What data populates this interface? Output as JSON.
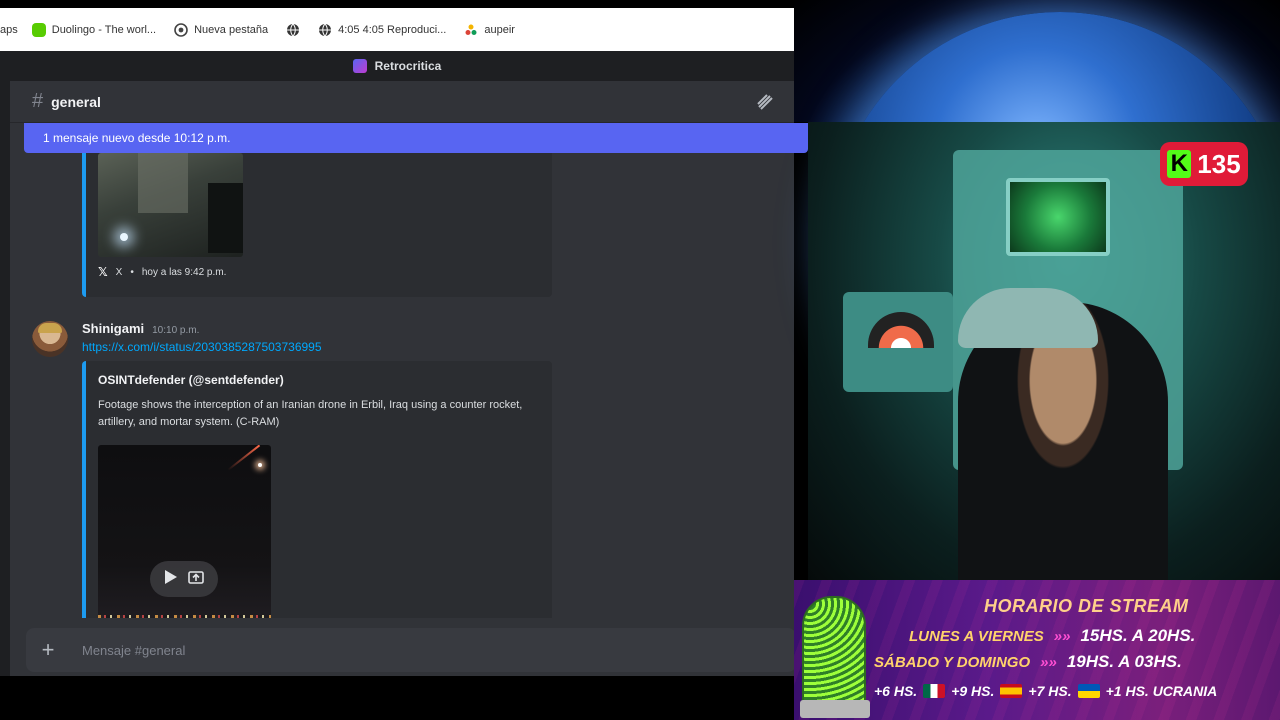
{
  "bookmarks": [
    {
      "label": "aps",
      "icon": "apps-icon"
    },
    {
      "label": "Duolingo - The worl...",
      "icon": "duolingo-icon"
    },
    {
      "label": "Nueva pestaña",
      "icon": "chrome-icon"
    },
    {
      "label": "",
      "icon": "globe-icon"
    },
    {
      "label": "4:05 4:05 Reproduci...",
      "icon": "globe-icon"
    },
    {
      "label": "aupeir",
      "icon": "aupeir-icon"
    }
  ],
  "app": {
    "server_name": "Retrocritica"
  },
  "channel": {
    "name": "general"
  },
  "banner": {
    "text": "1 mensaje nuevo desde 10:12 p.m."
  },
  "embed1": {
    "source": "X",
    "time": "hoy a las 9:42 p.m."
  },
  "message": {
    "username": "Shinigami",
    "timestamp": "10:10 p.m.",
    "link": "https://x.com/i/status/2030385287503736995",
    "embed": {
      "author": "OSINTdefender (@sentdefender)",
      "description": "Footage shows the interception of an Iranian drone in Erbil, Iraq using a counter rocket, artillery, and mortar system. (C-RAM)"
    }
  },
  "composer": {
    "placeholder": "Mensaje #general"
  },
  "stream": {
    "kick_viewers": "135",
    "schedule": {
      "title": "HORARIO DE STREAM",
      "rows": [
        {
          "days": "LUNES A VIERNES",
          "time": "15HS. A 20HS."
        },
        {
          "days": "SÁBADO Y DOMINGO",
          "time": "19HS. A 03HS."
        }
      ],
      "timezones": [
        "+6 HS.",
        "+9 HS.",
        "+7 HS.",
        "+1 HS. UCRANIA"
      ]
    }
  },
  "colors": {
    "discord_bg": "#313338",
    "blurple": "#5865f2",
    "link": "#00a8fc",
    "kick_green": "#53fc18"
  }
}
